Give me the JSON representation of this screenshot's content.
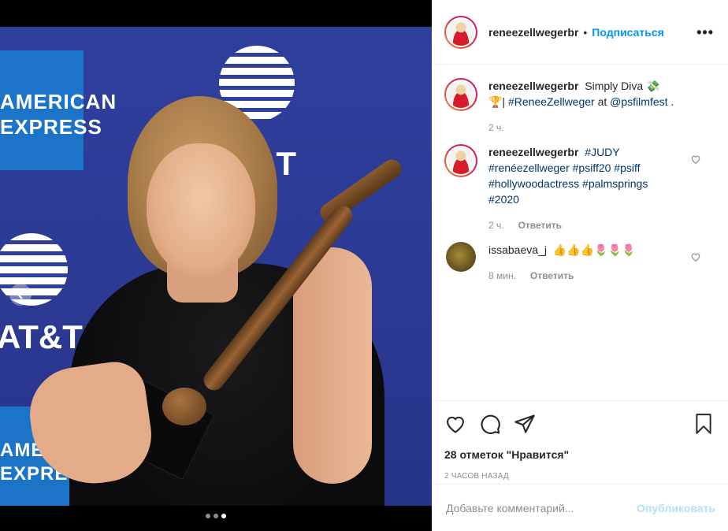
{
  "post": {
    "username": "reneezellwegerbr",
    "separator": "•",
    "follow_label": "Подписаться",
    "more_label": "•••"
  },
  "media": {
    "slides": 3,
    "active_slide": 3,
    "banner": {
      "amex_line1": "AMERICAN",
      "amex_line2": "EXPRESS",
      "amex2_line1": "AMERICAN",
      "amex2_line2": "EXPRESS",
      "att_text": "AT&T",
      "att_text_top": "&T"
    }
  },
  "comments": [
    {
      "username": "reneezellwegerbr",
      "text": "Simply Diva 💸🏆|",
      "links": "#ReneeZellweger",
      "at": "at",
      "mention": "@psfilmfest",
      "tail": ".",
      "time": "2 ч."
    },
    {
      "username": "reneezellwegerbr",
      "text": "#JUDY #renéezellweger #psiff20 #psiff #hollywoodactress #palmsprings #2020",
      "time": "2 ч.",
      "reply": "Ответить"
    },
    {
      "username": "issabaeva_j",
      "text": "👍👍👍🌷🌷🌷",
      "time": "8 мин.",
      "reply": "Ответить"
    }
  ],
  "actions": {
    "likes": "28 отметок \"Нравится\"",
    "date": "2 часов назад"
  },
  "composer": {
    "placeholder": "Добавьте комментарий...",
    "publish_label": "Опубликовать"
  },
  "colors": {
    "accent": "#0095f6",
    "publish_disabled": "#b2dffc",
    "link": "#00376b",
    "muted": "#8e8e8e"
  }
}
